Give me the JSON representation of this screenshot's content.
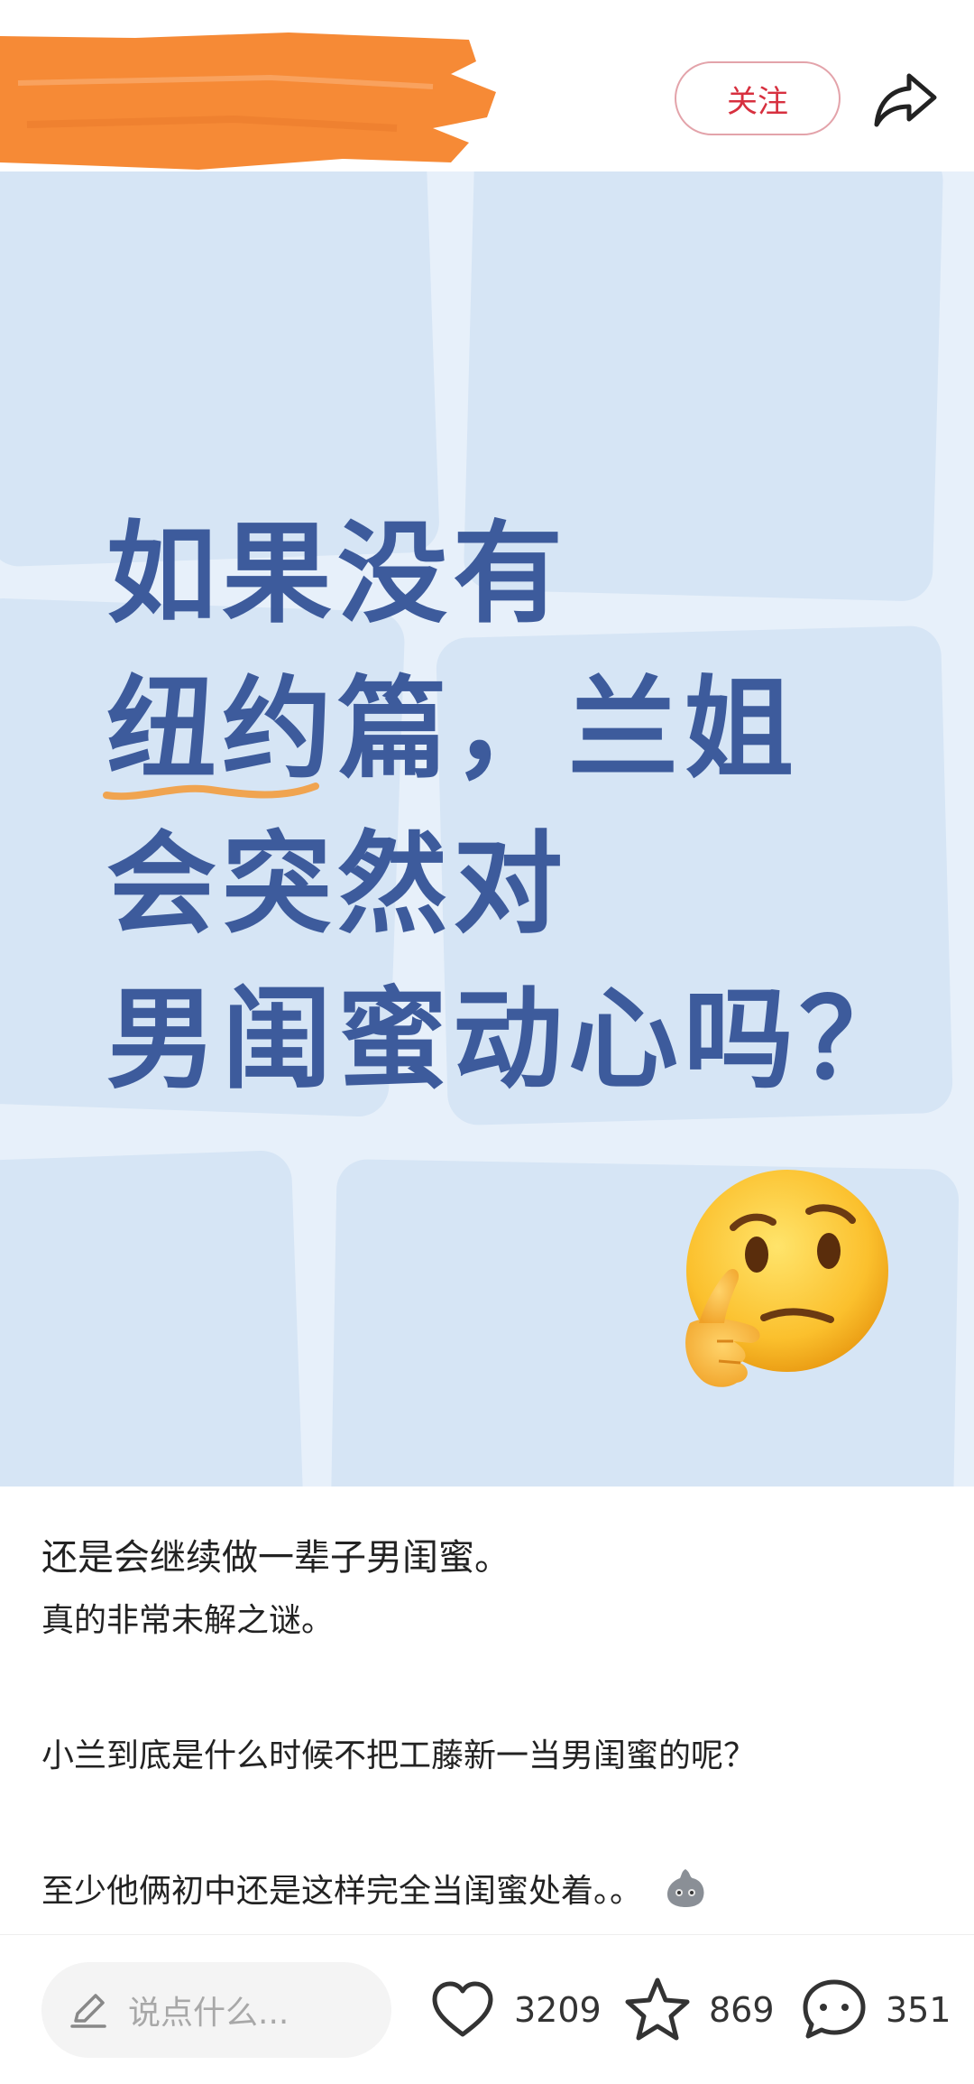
{
  "header": {
    "follow_label": "关注",
    "redaction_color": "#f68a36"
  },
  "post_image": {
    "headline_lines": [
      "如果没有",
      "纽约",
      "篇，兰姐",
      "会突然对",
      "男闺蜜动心吗？"
    ],
    "text_color": "#3d5b9c",
    "underline_color": "#f0a450",
    "background_color": "#e7f0fa",
    "emoji": "thinking-face"
  },
  "post_text": {
    "lines": [
      "还是会继续做一辈子男闺蜜。",
      "真的非常未解之谜。",
      "小兰到底是什么时候不把工藤新一当男闺蜜的呢？",
      "至少他俩初中还是这样完全当闺蜜处着。。"
    ]
  },
  "bottom_bar": {
    "comment_placeholder": "说点什么...",
    "likes": "3209",
    "favorites": "869",
    "comments": "351"
  }
}
